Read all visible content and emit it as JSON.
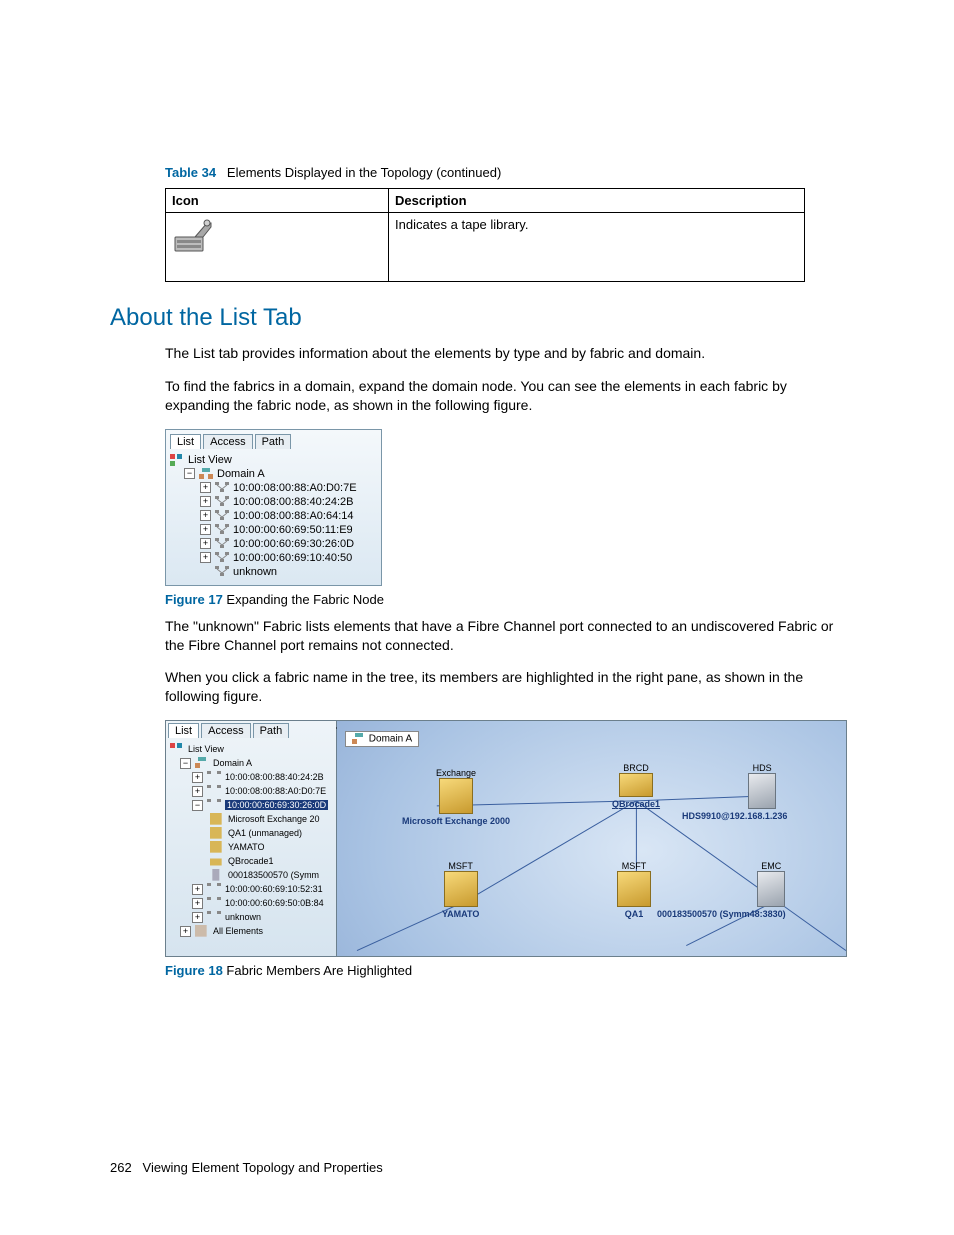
{
  "table": {
    "caption_label": "Table 34",
    "caption_text": "Elements Displayed in the Topology (continued)",
    "col_icon": "Icon",
    "col_desc": "Description",
    "row_desc": "Indicates a tape library."
  },
  "section_title": "About the List Tab",
  "para1": "The List tab provides information about the elements by type and by fabric and domain.",
  "para2": "To find the fabrics in a domain, expand the domain node. You can see the elements in each fabric by expanding the fabric node, as shown in the following figure.",
  "fig17": {
    "tabs": [
      "List",
      "Access",
      "Path"
    ],
    "root": "List View",
    "domain": "Domain A",
    "items": [
      "10:00:08:00:88:A0:D0:7E",
      "10:00:08:00:88:40:24:2B",
      "10:00:08:00:88:A0:64:14",
      "10:00:00:60:69:50:11:E9",
      "10:00:00:60:69:30:26:0D",
      "10:00:00:60:69:10:40:50",
      "unknown"
    ],
    "caption_label": "Figure 17",
    "caption_text": "Expanding the Fabric Node"
  },
  "para3": "The \"unknown\" Fabric lists elements that have a Fibre Channel port connected to an undiscovered Fabric or the Fibre Channel port remains not connected.",
  "para4": "When you click a fabric name in the tree, its members are highlighted in the right pane, as shown in the following figure.",
  "fig18": {
    "tabs": [
      "List",
      "Access",
      "Path"
    ],
    "root": "List View",
    "domain": "Domain A",
    "tree": [
      "10:00:08:00:88:40:24:2B",
      "10:00:08:00:88:A0:D0:7E",
      "10:00:00:60:69:30:26:0D",
      "Microsoft Exchange 20",
      "QA1 (unmanaged)",
      "YAMATO",
      "QBrocade1",
      "000183500570 (Symm",
      "10:00:00:60:69:10:52:31",
      "10:00:00:60:69:50:0B:84",
      "unknown",
      "All Elements"
    ],
    "topo_title": "Domain A",
    "nodes": {
      "exchange_tag": "Exchange",
      "exchange_lbl": "Microsoft Exchange 2000",
      "brcd_tag": "BRCD",
      "brcd_lbl": "QBrocade1",
      "hds_tag": "HDS",
      "hds_lbl": "HDS9910@192.168.1.236",
      "msft1_tag": "MSFT",
      "msft1_lbl": "YAMATO",
      "msft2_tag": "MSFT",
      "msft2_lbl": "QA1",
      "emc_tag": "EMC",
      "emc_lbl": "000183500570 (Symm48:3830)"
    },
    "caption_label": "Figure 18",
    "caption_text": "Fabric Members Are Highlighted"
  },
  "footer_page": "262",
  "footer_text": "Viewing Element Topology and Properties"
}
